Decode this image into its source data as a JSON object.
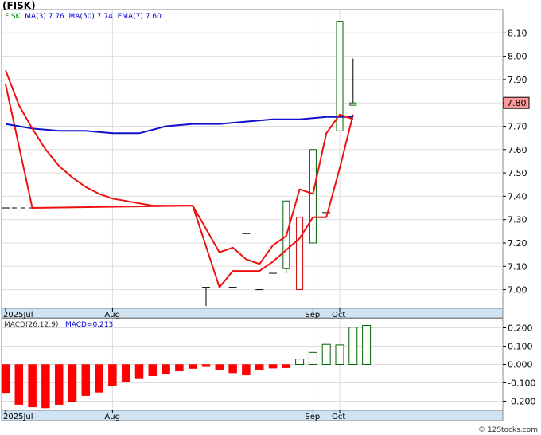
{
  "header": {
    "title": "(FISK)"
  },
  "price_legend": {
    "symbol": "FISK",
    "ma3_label": "MA(3)",
    "ma3_value": "7.76",
    "ma50_label": "MA(50)",
    "ma50_value": "7.74",
    "ema7_label": "EMA(7)",
    "ema7_value": "7.60"
  },
  "macd_legend": {
    "params": "MACD(26,12,9)",
    "value_label": "MACD=0.213"
  },
  "footer": {
    "credit": "© 12Stocks.com"
  },
  "colors": {
    "up_candle": "#006600",
    "down_candle": "#cc0000",
    "ma_red": "#ee1111",
    "ma_blue": "#1111cc",
    "macd_neg": "#ff0000",
    "macd_pos": "#006600",
    "last_price_box": "#ff9999"
  },
  "chart_data": [
    {
      "type": "candlestick",
      "name": "price",
      "last_price_label": "7.80",
      "y_ticks": [
        7.0,
        7.1,
        7.2,
        7.3,
        7.4,
        7.5,
        7.6,
        7.7,
        7.8,
        7.9,
        8.0,
        8.1
      ],
      "y_tick_labels": [
        "7.00",
        "7.10",
        "7.20",
        "7.30",
        "7.40",
        "7.50",
        "7.60",
        "7.70",
        "7.80",
        "7.90",
        "8.00",
        "8.10"
      ],
      "ylim": [
        6.92,
        8.2
      ],
      "x_labels": [
        "2025Jul",
        "Aug",
        "Sep",
        "Oct"
      ],
      "grid": true,
      "ohlc": [
        {
          "i": 0,
          "o": 7.35,
          "h": 7.35,
          "l": 7.35,
          "c": 7.35
        },
        {
          "i": 15,
          "o": 7.01,
          "h": 7.01,
          "l": 6.93,
          "c": 7.01
        },
        {
          "i": 17,
          "o": 7.01,
          "h": 7.01,
          "l": 7.01,
          "c": 7.01
        },
        {
          "i": 18,
          "o": 7.24,
          "h": 7.24,
          "l": 7.24,
          "c": 7.24
        },
        {
          "i": 19,
          "o": 7.0,
          "h": 7.0,
          "l": 7.0,
          "c": 7.0
        },
        {
          "i": 20,
          "o": 7.07,
          "h": 7.07,
          "l": 7.07,
          "c": 7.07
        },
        {
          "i": 21,
          "o": 7.09,
          "h": 7.38,
          "l": 7.07,
          "c": 7.38
        },
        {
          "i": 22,
          "o": 7.31,
          "h": 7.31,
          "l": 7.0,
          "c": 7.0
        },
        {
          "i": 23,
          "o": 7.2,
          "h": 7.6,
          "l": 7.2,
          "c": 7.6
        },
        {
          "i": 24,
          "o": 7.33,
          "h": 7.33,
          "l": 7.33,
          "c": 7.33
        },
        {
          "i": 25,
          "o": 7.68,
          "h": 8.15,
          "l": 7.68,
          "c": 8.15
        },
        {
          "i": 26,
          "o": 7.79,
          "h": 7.99,
          "l": 7.79,
          "c": 7.8
        }
      ],
      "series": [
        {
          "name": "MA(3)",
          "color": "#ee1111",
          "points": [
            [
              0,
              7.88
            ],
            [
              2,
              7.35
            ],
            [
              14,
              7.36
            ],
            [
              16,
              7.01
            ],
            [
              17,
              7.08
            ],
            [
              19,
              7.08
            ],
            [
              20,
              7.12
            ],
            [
              21,
              7.17
            ],
            [
              22,
              7.22
            ],
            [
              23,
              7.31
            ],
            [
              24,
              7.31
            ],
            [
              25,
              7.52
            ],
            [
              26,
              7.75
            ]
          ]
        },
        {
          "name": "MA(50)",
          "color": "#1111cc",
          "points": [
            [
              0,
              7.71
            ],
            [
              2,
              7.69
            ],
            [
              4,
              7.68
            ],
            [
              6,
              7.68
            ],
            [
              8,
              7.67
            ],
            [
              10,
              7.67
            ],
            [
              12,
              7.7
            ],
            [
              14,
              7.71
            ],
            [
              16,
              7.71
            ],
            [
              18,
              7.72
            ],
            [
              20,
              7.73
            ],
            [
              22,
              7.73
            ],
            [
              24,
              7.74
            ],
            [
              26,
              7.74
            ]
          ]
        },
        {
          "name": "EMA(7)",
          "color": "#ee1111",
          "points": [
            [
              0,
              7.94
            ],
            [
              1,
              7.79
            ],
            [
              2,
              7.69
            ],
            [
              3,
              7.6
            ],
            [
              4,
              7.53
            ],
            [
              5,
              7.48
            ],
            [
              6,
              7.44
            ],
            [
              7,
              7.41
            ],
            [
              8,
              7.39
            ],
            [
              9,
              7.38
            ],
            [
              10,
              7.37
            ],
            [
              11,
              7.36
            ],
            [
              12,
              7.36
            ],
            [
              13,
              7.36
            ],
            [
              14,
              7.36
            ],
            [
              15,
              7.26
            ],
            [
              16,
              7.16
            ],
            [
              17,
              7.18
            ],
            [
              18,
              7.13
            ],
            [
              19,
              7.11
            ],
            [
              20,
              7.19
            ],
            [
              21,
              7.23
            ],
            [
              22,
              7.43
            ],
            [
              23,
              7.41
            ],
            [
              24,
              7.67
            ],
            [
              25,
              7.75
            ],
            [
              26,
              7.73
            ]
          ]
        }
      ]
    },
    {
      "type": "bar",
      "name": "macd",
      "y_ticks": [
        -0.2,
        -0.1,
        0.0,
        0.1,
        0.2
      ],
      "y_tick_labels": [
        "-0.200",
        "-0.100",
        "0.000",
        "0.100",
        "0.200"
      ],
      "ylim": [
        -0.25,
        0.25
      ],
      "x_labels": [
        "2025Jul",
        "Aug",
        "Sep",
        "Oct"
      ],
      "grid": true,
      "values": [
        -0.154,
        -0.218,
        -0.232,
        -0.237,
        -0.218,
        -0.202,
        -0.17,
        -0.152,
        -0.116,
        -0.096,
        -0.078,
        -0.062,
        -0.05,
        -0.036,
        -0.022,
        -0.012,
        -0.028,
        -0.046,
        -0.058,
        -0.028,
        -0.02,
        -0.018,
        0.03,
        0.066,
        0.11,
        0.107,
        0.203,
        0.213
      ]
    }
  ]
}
